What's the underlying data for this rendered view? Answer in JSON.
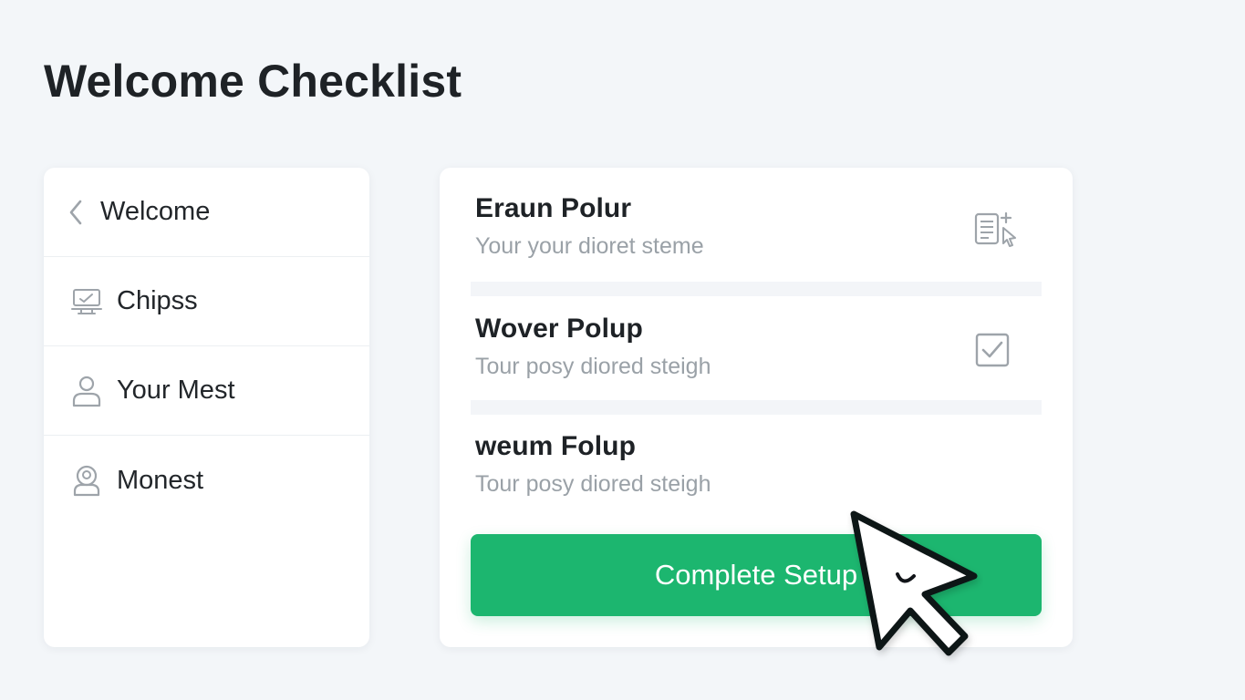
{
  "page": {
    "title": "Welcome Checklist"
  },
  "sidebar": {
    "items": [
      {
        "label": "Welcome",
        "icon": "chevron-left-icon"
      },
      {
        "label": "Chipss",
        "icon": "monitor-icon"
      },
      {
        "label": "Your Mest",
        "icon": "user-icon"
      },
      {
        "label": "Monest",
        "icon": "user-badge-icon"
      }
    ]
  },
  "tasks": [
    {
      "title": "Eraun Polur",
      "subtitle": "Your your dioret steme",
      "icon": "document-add-icon"
    },
    {
      "title": "Wover Polup",
      "subtitle": "Tour posy diored steigh",
      "icon": "checkbox-checked-icon"
    },
    {
      "title": "weum Folup",
      "subtitle": "Tour posy diored steigh"
    }
  ],
  "cta": {
    "label": "Complete Setup"
  },
  "colors": {
    "accent": "#1cb66f",
    "background": "#f3f6f9",
    "card": "#ffffff",
    "muted_text": "#9aa1a7",
    "icon": "#9ea4aa"
  }
}
